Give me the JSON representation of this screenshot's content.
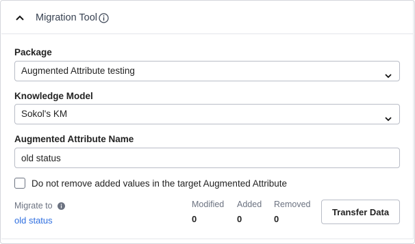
{
  "header": {
    "title": "Migration Tool",
    "collapse_icon": "chevron-up-icon",
    "info_icon": "info-circle-icon"
  },
  "package": {
    "label": "Package",
    "value": "Augmented Attribute testing"
  },
  "knowledge_model": {
    "label": "Knowledge Model",
    "value": "Sokol's KM"
  },
  "attribute_name": {
    "label": "Augmented Attribute Name",
    "value": "old status"
  },
  "keep_values": {
    "label": "Do not remove added values in the target Augmented Attribute",
    "checked": false
  },
  "migrate": {
    "label": "Migrate to",
    "target": "old status"
  },
  "stats": {
    "modified_label": "Modified",
    "modified_value": "0",
    "added_label": "Added",
    "added_value": "0",
    "removed_label": "Removed",
    "removed_value": "0"
  },
  "actions": {
    "transfer_label": "Transfer Data"
  },
  "colors": {
    "link": "#2f6fe0",
    "border": "#b8bcc6"
  }
}
